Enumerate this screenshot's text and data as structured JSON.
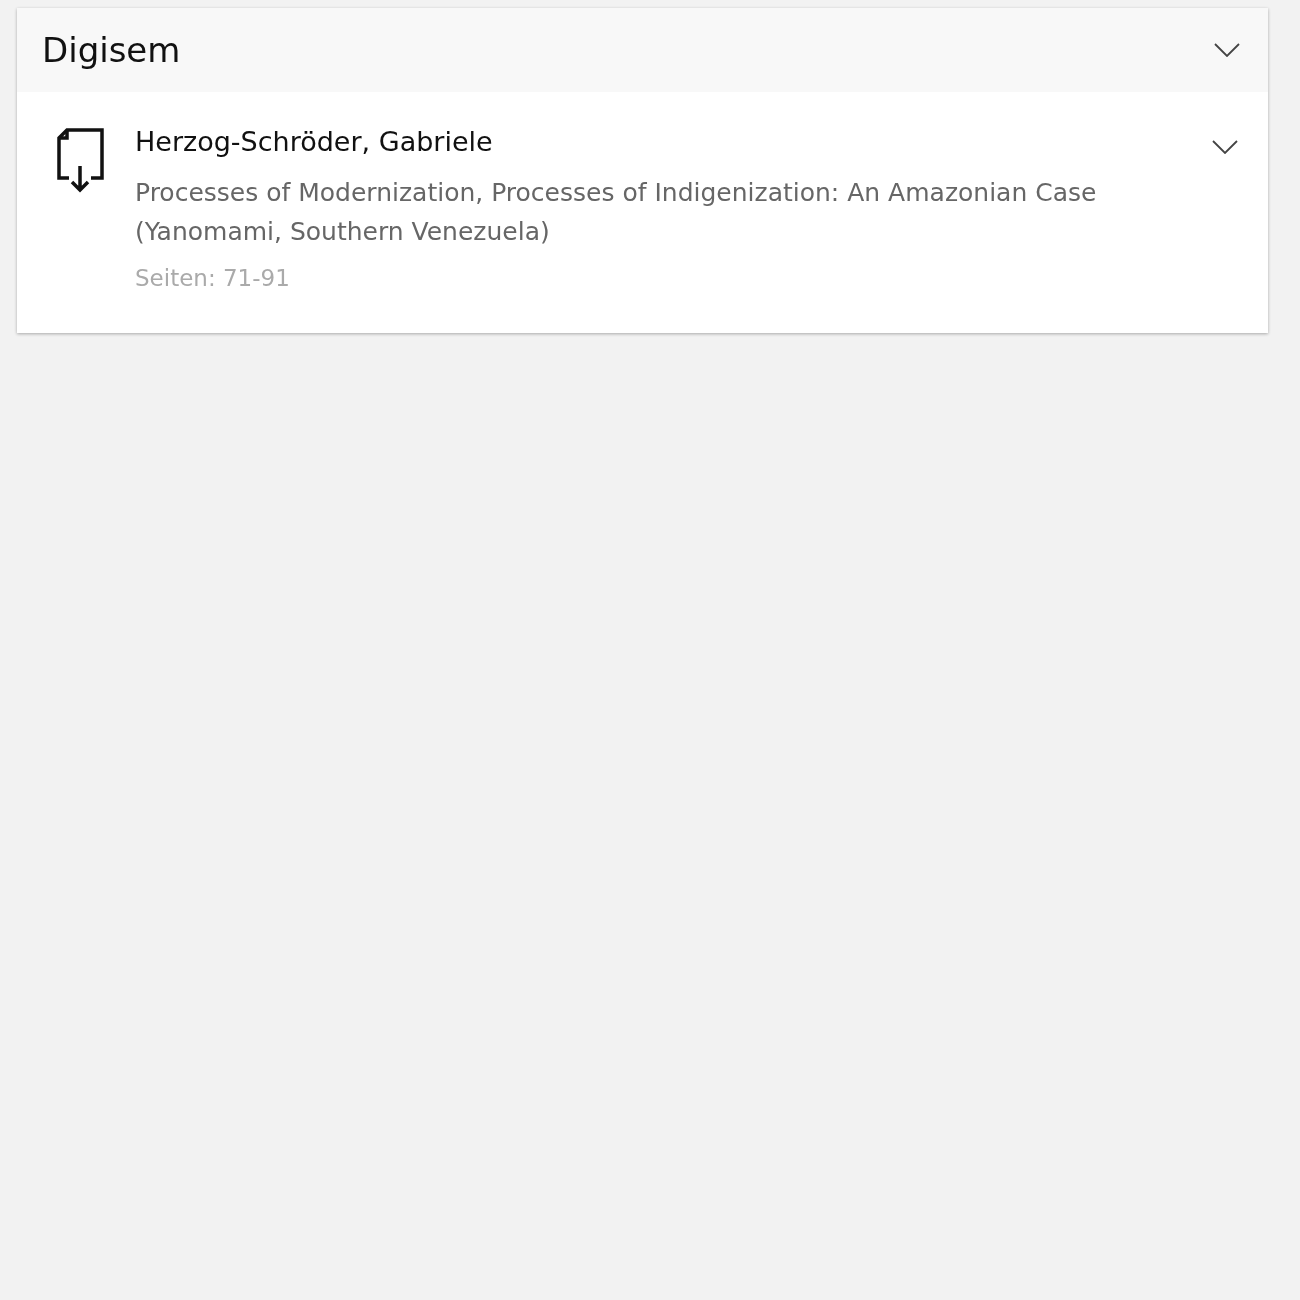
{
  "panel": {
    "title": "Digisem",
    "expanded": true,
    "items": [
      {
        "author": "Herzog-Schröder, Gabriele",
        "title": "Processes of Modernization, Processes of Indigenization: An Amazonian Case (Yanomami, Southern Venezuela)",
        "pages": "Seiten: 71-91",
        "expanded": false
      }
    ]
  }
}
